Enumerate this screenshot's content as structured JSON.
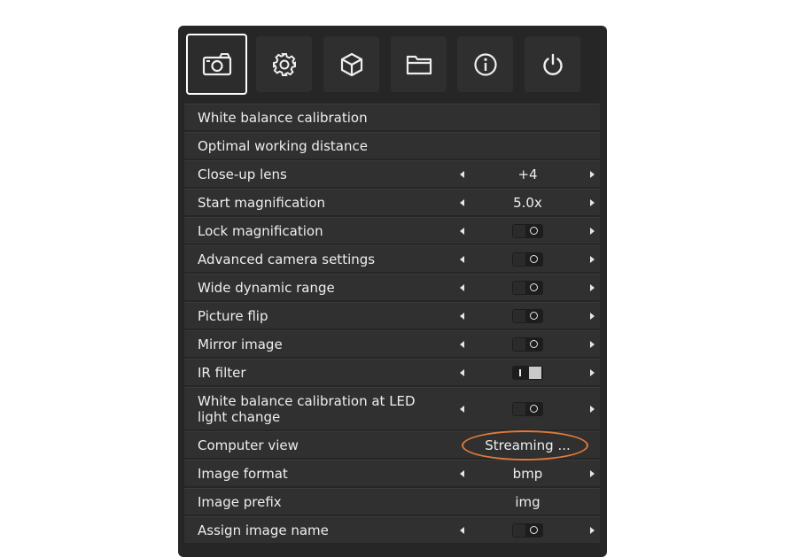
{
  "tabs": [
    {
      "icon": "camera-icon",
      "active": true
    },
    {
      "icon": "gear-icon",
      "active": false
    },
    {
      "icon": "cube-icon",
      "active": false
    },
    {
      "icon": "folder-icon",
      "active": false
    },
    {
      "icon": "info-icon",
      "active": false
    },
    {
      "icon": "power-icon",
      "active": false
    }
  ],
  "menu": {
    "white_balance_calibration": "White balance calibration",
    "optimal_working_distance": "Optimal working distance",
    "close_up_lens": {
      "label": "Close-up lens",
      "value": "+4"
    },
    "start_magnification": {
      "label": "Start magnification",
      "value": "5.0x"
    },
    "lock_magnification": {
      "label": "Lock magnification",
      "state": "off"
    },
    "advanced_camera_settings": {
      "label": "Advanced camera settings",
      "state": "off"
    },
    "wide_dynamic_range": {
      "label": "Wide dynamic range",
      "state": "off"
    },
    "picture_flip": {
      "label": "Picture flip",
      "state": "off"
    },
    "mirror_image": {
      "label": "Mirror image",
      "state": "off"
    },
    "ir_filter": {
      "label": "IR filter",
      "state": "on"
    },
    "wb_calibration_led": {
      "label": "White balance calibration at LED light change",
      "state": "off"
    },
    "computer_view": {
      "label": "Computer view",
      "value": "Streaming ..."
    },
    "image_format": {
      "label": "Image format",
      "value": "bmp"
    },
    "image_prefix": {
      "label": "Image prefix",
      "value": "img"
    },
    "assign_image_name": {
      "label": "Assign image name",
      "state": "off"
    }
  },
  "colors": {
    "panel": "#262626",
    "row": "#303030",
    "highlight": "#e07a3a"
  }
}
